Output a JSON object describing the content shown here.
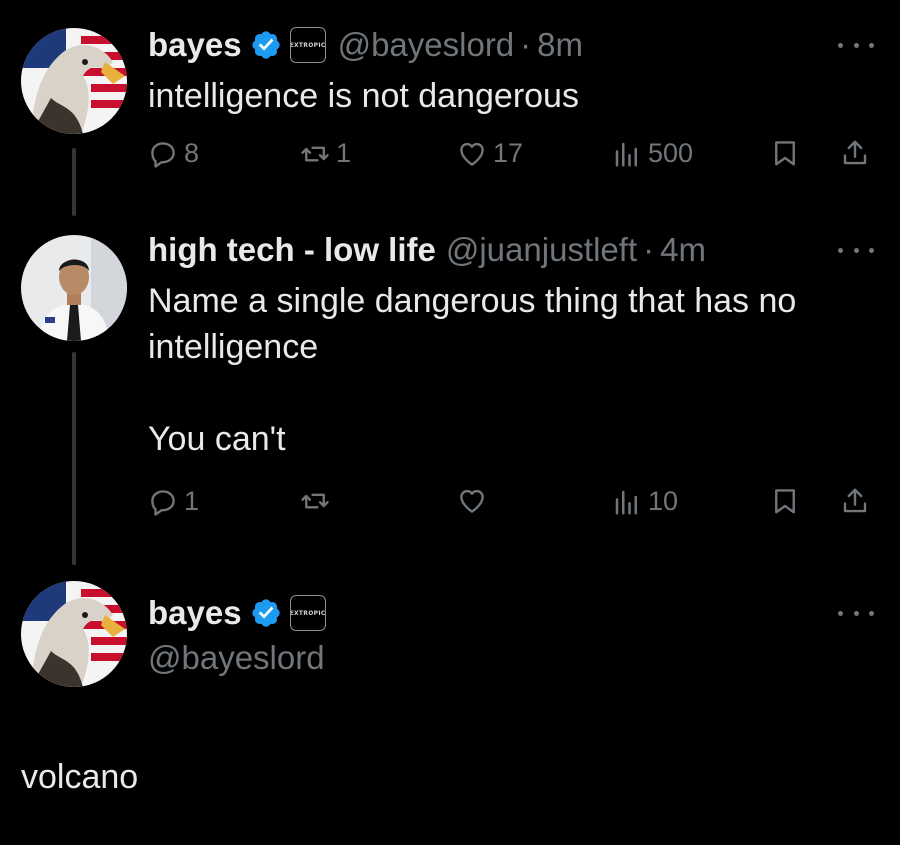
{
  "colors": {
    "background": "#000000",
    "text": "#e7e9ea",
    "muted": "#71767b",
    "verified": "#1d9bf0",
    "line": "#333639"
  },
  "tweets": [
    {
      "display_name": "bayes",
      "handle": "@bayeslord",
      "separator": "·",
      "time": "8m",
      "verified": true,
      "affiliation_badge": "EXTROPIC",
      "text_lines": [
        "intelligence is not dangerous"
      ],
      "stats": {
        "replies": "8",
        "reposts": "1",
        "likes": "17",
        "views": "500"
      }
    },
    {
      "display_name": "high tech - low life",
      "handle": "@juanjustleft",
      "separator": "·",
      "time": "4m",
      "text_lines": [
        "Name a single dangerous thing that has no",
        "intelligence",
        "",
        "You can't"
      ],
      "stats": {
        "replies": "1",
        "views": "10"
      }
    },
    {
      "display_name": "bayes",
      "handle": "@bayeslord",
      "verified": true,
      "affiliation_badge": "EXTROPIC",
      "text": "volcano"
    }
  ],
  "icons": [
    "reply-icon",
    "repost-icon",
    "like-icon",
    "views-icon",
    "bookmark-icon",
    "share-icon",
    "more-icon",
    "verified-icon"
  ]
}
